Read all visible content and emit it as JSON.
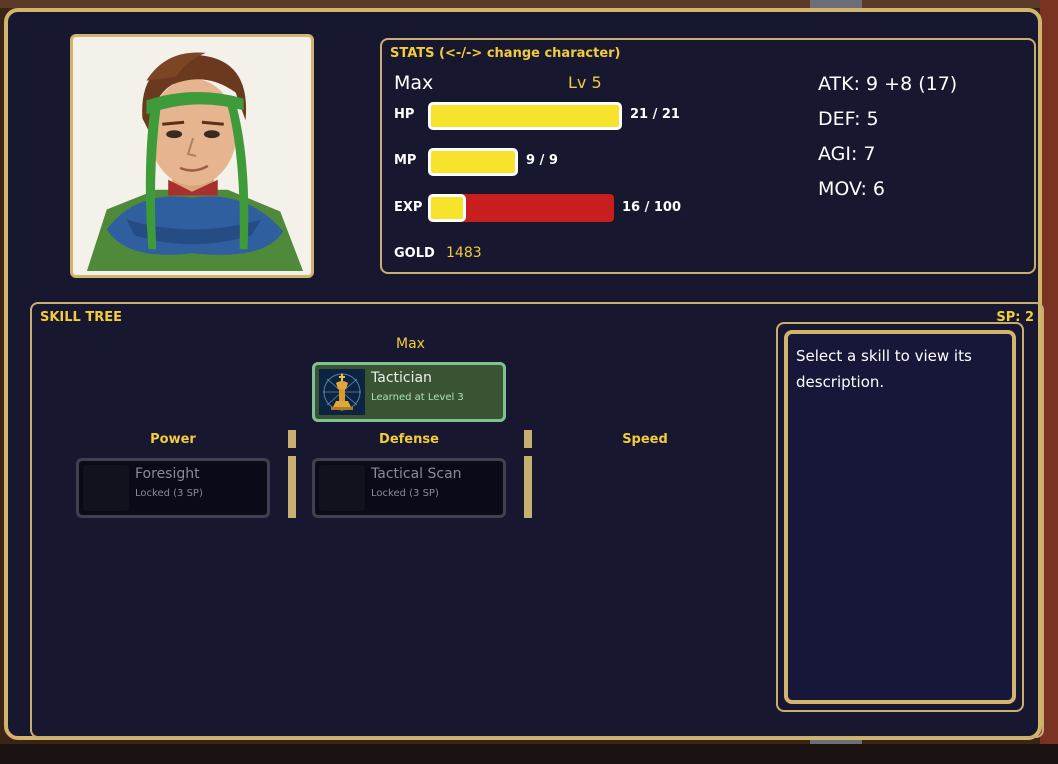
{
  "stats": {
    "title": "STATS",
    "hint": "(<-/-> change character)",
    "name": "Max",
    "level": "Lv 5",
    "hp": {
      "label": "HP",
      "value": "21 / 21",
      "fill": 1.0
    },
    "mp": {
      "label": "MP",
      "value": "9 / 9",
      "fill": 1.0
    },
    "exp": {
      "label": "EXP",
      "value": "16 / 100",
      "fill": 0.16
    },
    "gold": {
      "label": "GOLD",
      "value": "1483"
    },
    "atk": "ATK: 9 +8 (17)",
    "def": "DEF: 5",
    "agi": "AGI: 7",
    "mov": "MOV: 6"
  },
  "skill_tree": {
    "title": "SKILL TREE",
    "sp": "SP: 2",
    "root_label": "Max",
    "root_skill": {
      "name": "Tactician",
      "sub": "Learned at Level 3",
      "icon": "chess-king-icon"
    },
    "columns": [
      {
        "label": "Power",
        "skills": [
          {
            "name": "Foresight",
            "sub": "Locked (3 SP)"
          }
        ]
      },
      {
        "label": "Defense",
        "skills": [
          {
            "name": "Tactical Scan",
            "sub": "Locked (3 SP)"
          }
        ]
      },
      {
        "label": "Speed",
        "skills": []
      }
    ],
    "description": "Select a skill to view its description."
  },
  "colors": {
    "accent_gold": "#d2b46c",
    "panel_bg": "#17172f",
    "bar_yellow": "#f7e22c",
    "exp_red": "#c81e1e",
    "learned_green": "#7fc291"
  }
}
